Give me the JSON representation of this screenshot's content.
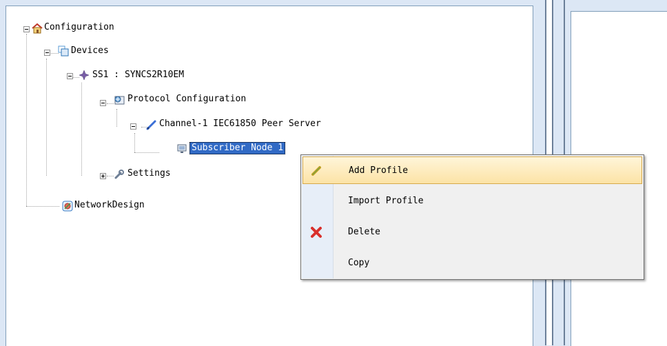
{
  "tree": {
    "root": {
      "label": "Configuration",
      "icon": "home-icon"
    },
    "devices": {
      "label": "Devices",
      "icon": "devices-icon"
    },
    "device_node": {
      "label": "SS1 : SYNCS2R10EM",
      "icon": "device-diamond-icon"
    },
    "protocol": {
      "label": "Protocol Configuration",
      "icon": "protocol-config-icon"
    },
    "channel": {
      "label": "Channel-1 IEC61850 Peer Server",
      "icon": "channel-pen-icon"
    },
    "subscriber": {
      "label": "Subscriber Node 1",
      "icon": "monitor-icon",
      "selected": true
    },
    "settings": {
      "label": "Settings",
      "icon": "wrench-icon"
    },
    "network": {
      "label": "NetworkDesign",
      "icon": "network-design-icon"
    }
  },
  "context_menu": {
    "items": [
      {
        "label": "Add Profile",
        "icon": "add-profile-icon",
        "highlighted": true
      },
      {
        "label": "Import Profile",
        "icon": ""
      },
      {
        "label": "Delete",
        "icon": "delete-x-icon"
      },
      {
        "label": "Copy",
        "icon": ""
      }
    ]
  },
  "colors": {
    "selection": "#316ac5",
    "menu_highlight": "#fce3a6",
    "background": "#dce7f5"
  }
}
